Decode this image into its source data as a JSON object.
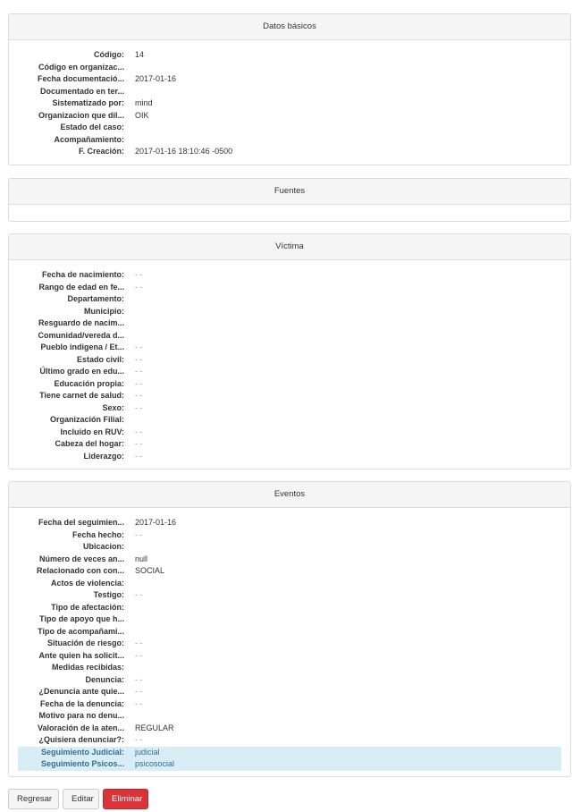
{
  "panels": {
    "basic": {
      "title": "Datos básicos",
      "rows": [
        {
          "label": "Código:",
          "value": "14"
        },
        {
          "label": "Código en organizac...",
          "value": ""
        },
        {
          "label": "Fecha documentació...",
          "value": "2017-01-16"
        },
        {
          "label": "Documentado en ter...",
          "value": ""
        },
        {
          "label": "Sistematizado por:",
          "value": "mind"
        },
        {
          "label": "Organizacion que dil...",
          "value": "OIK"
        },
        {
          "label": "Estado del caso:",
          "value": ""
        },
        {
          "label": "Acompañamiento:",
          "value": ""
        },
        {
          "label": "F. Creación:",
          "value": "2017-01-16 18:10:46 -0500"
        }
      ]
    },
    "sources": {
      "title": "Fuentes"
    },
    "victim": {
      "title": "Víctima",
      "rows": [
        {
          "label": "Fecha de nacimiento:",
          "value": "- -"
        },
        {
          "label": "Rango de edad en fe...",
          "value": "- -"
        },
        {
          "label": "Departamento:",
          "value": ""
        },
        {
          "label": "Municipio:",
          "value": ""
        },
        {
          "label": "Resguardo de nacim...",
          "value": ""
        },
        {
          "label": "Comunidad/vereda d...",
          "value": ""
        },
        {
          "label": "Pueblo indigena / Et...",
          "value": "- -"
        },
        {
          "label": "Estado civil:",
          "value": "- -"
        },
        {
          "label": "Último grado en edu...",
          "value": "- -"
        },
        {
          "label": "Educación propia:",
          "value": "- -"
        },
        {
          "label": "Tiene carnet de salud:",
          "value": "- -"
        },
        {
          "label": "Sexo:",
          "value": "- -"
        },
        {
          "label": "Organización Filial:",
          "value": ""
        },
        {
          "label": "Incluido en RUV:",
          "value": "- -"
        },
        {
          "label": "Cabeza del hogar:",
          "value": "- -"
        },
        {
          "label": "Liderazgo:",
          "value": "- -"
        }
      ]
    },
    "events": {
      "title": "Eventos",
      "rows": [
        {
          "label": "Fecha del seguimien...",
          "value": "2017-01-16"
        },
        {
          "label": "Fecha hecho:",
          "value": "- -"
        },
        {
          "label": "Ubicacion:",
          "value": ""
        },
        {
          "label": "Número de veces an...",
          "value": "null"
        },
        {
          "label": "Relacionado con con...",
          "value": "SOCIAL"
        },
        {
          "label": "Actos de violencia:",
          "value": ""
        },
        {
          "label": "Testigo:",
          "value": "- -"
        },
        {
          "label": "Tipo de afectación:",
          "value": ""
        },
        {
          "label": "Tipo de apoyo que h...",
          "value": ""
        },
        {
          "label": "Tipo de acompañami...",
          "value": ""
        },
        {
          "label": "Situación de riesgo:",
          "value": "- -"
        },
        {
          "label": "Ante quien ha solicit...",
          "value": "- -"
        },
        {
          "label": "Medidas recibidas:",
          "value": ""
        },
        {
          "label": "Denuncia:",
          "value": "- -"
        },
        {
          "label": "¿Denuncia ante quie...",
          "value": "- -"
        },
        {
          "label": "Fecha de la denuncia:",
          "value": "- -"
        },
        {
          "label": "Motivo para no denu...",
          "value": ""
        },
        {
          "label": "Valoración de la aten...",
          "value": "REGULAR"
        },
        {
          "label": "¿Quisiera denunciar?:",
          "value": "- -"
        },
        {
          "label": "Seguimiento Judicial:",
          "value": "judicial",
          "highlight": true
        },
        {
          "label": "Seguimiento Psicos...",
          "value": "psicosocial",
          "highlight": true
        }
      ]
    }
  },
  "buttons": {
    "back": "Regresar",
    "edit": "Editar",
    "delete": "Eliminar"
  },
  "colors": {
    "highlight_bg": "#d9edf7",
    "highlight_text": "#31708f",
    "danger": "#d9343a"
  }
}
